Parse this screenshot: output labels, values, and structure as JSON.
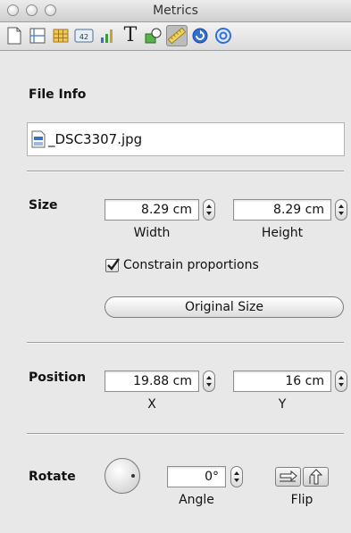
{
  "window": {
    "title": "Metrics"
  },
  "toolbar": {
    "tools": [
      {
        "name": "document-inspector",
        "icon": "document-icon"
      },
      {
        "name": "layout-inspector",
        "icon": "layout-icon"
      },
      {
        "name": "table-inspector",
        "icon": "table-icon"
      },
      {
        "name": "cell-format-inspector",
        "icon": "cell-format-icon"
      },
      {
        "name": "chart-inspector",
        "icon": "chart-icon"
      },
      {
        "name": "text-inspector",
        "icon": "text-icon"
      },
      {
        "name": "graphic-inspector",
        "icon": "graphic-icon"
      },
      {
        "name": "metrics-inspector",
        "icon": "ruler-icon",
        "active": true
      },
      {
        "name": "hyperlink-inspector",
        "icon": "hyperlink-icon"
      },
      {
        "name": "quicktime-inspector",
        "icon": "quicktime-icon"
      }
    ],
    "text_tool_glyph": "T"
  },
  "file_info": {
    "label": "File Info",
    "filename": "_DSC3307.jpg"
  },
  "size": {
    "label": "Size",
    "width_value": "8.29 cm",
    "height_value": "8.29 cm",
    "width_label": "Width",
    "height_label": "Height",
    "constrain_label": "Constrain proportions",
    "constrain_checked": true,
    "original_size_label": "Original Size"
  },
  "position": {
    "label": "Position",
    "x_value": "19.88 cm",
    "y_value": "16 cm",
    "x_label": "X",
    "y_label": "Y"
  },
  "rotate": {
    "label": "Rotate",
    "angle_value": "0°",
    "angle_label": "Angle",
    "flip_label": "Flip"
  },
  "colors": {
    "accent_blue": "#2f6fd6",
    "check_blue": "#1e4fa8"
  }
}
